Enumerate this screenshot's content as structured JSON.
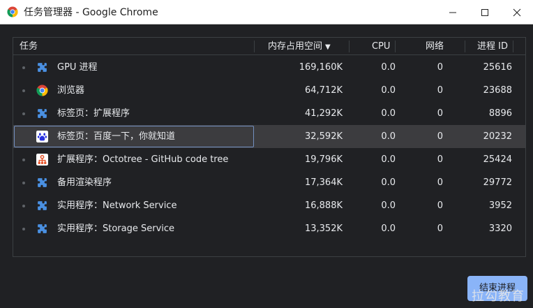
{
  "window": {
    "title": "任务管理器 - Google Chrome"
  },
  "columns": {
    "task": "任务",
    "memory": "内存占用空间",
    "cpu": "CPU",
    "network": "网络",
    "pid": "进程 ID"
  },
  "rows": [
    {
      "icon": "extension-puzzle-icon",
      "name": "GPU 进程",
      "memory": "169,160K",
      "cpu": "0.0",
      "network": "0",
      "pid": "25616"
    },
    {
      "icon": "chrome-icon",
      "name": "浏览器",
      "memory": "64,712K",
      "cpu": "0.0",
      "network": "0",
      "pid": "23688"
    },
    {
      "icon": "extension-puzzle-icon",
      "name": "标签页：扩展程序",
      "memory": "41,292K",
      "cpu": "0.0",
      "network": "0",
      "pid": "8896"
    },
    {
      "icon": "baidu-paw-icon",
      "name": "标签页：百度一下，你就知道",
      "memory": "32,592K",
      "cpu": "0.0",
      "network": "0",
      "pid": "20232"
    },
    {
      "icon": "octotree-icon",
      "name": "扩展程序：Octotree - GitHub code tree",
      "memory": "19,796K",
      "cpu": "0.0",
      "network": "0",
      "pid": "25424"
    },
    {
      "icon": "extension-puzzle-icon",
      "name": "备用渲染程序",
      "memory": "17,364K",
      "cpu": "0.0",
      "network": "0",
      "pid": "29772"
    },
    {
      "icon": "extension-puzzle-icon",
      "name": "实用程序：Network Service",
      "memory": "16,888K",
      "cpu": "0.0",
      "network": "0",
      "pid": "3952"
    },
    {
      "icon": "extension-puzzle-icon",
      "name": "实用程序：Storage Service",
      "memory": "13,352K",
      "cpu": "0.0",
      "network": "0",
      "pid": "3320"
    }
  ],
  "end_process_label": "结束进程",
  "watermark": "拉勾教育",
  "colors": {
    "background": "#202124",
    "selected_row": "#3c3c3f",
    "accent": "#8ab4f8",
    "puzzle_icon": "#4a90e2"
  }
}
